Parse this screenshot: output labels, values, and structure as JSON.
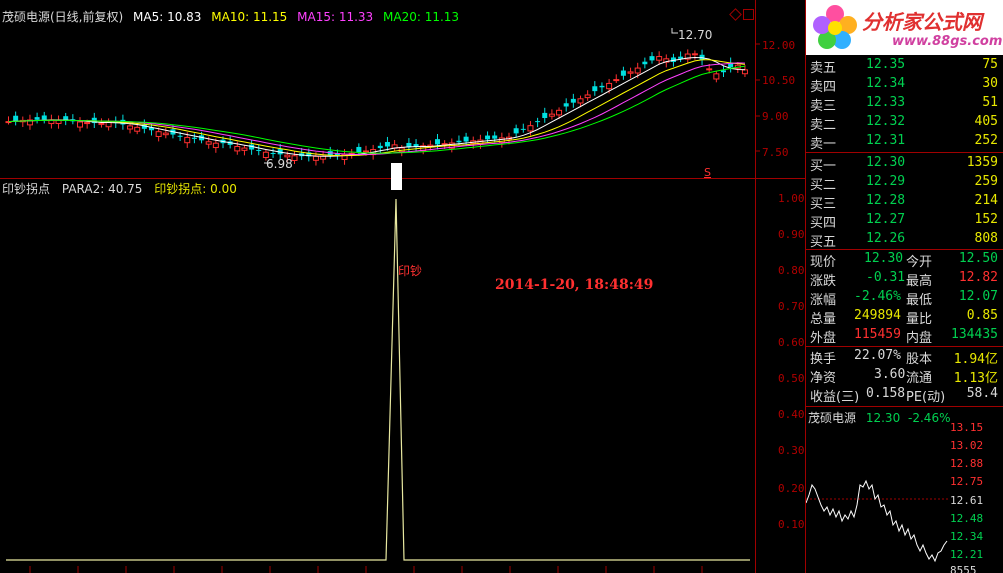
{
  "main_chart": {
    "title": "茂硕电源(日线,前复权)",
    "ma": [
      {
        "label": "MA5: 10.83",
        "color": "#ffffff"
      },
      {
        "label": "MA10: 11.15",
        "color": "#ffff00"
      },
      {
        "label": "MA15: 11.33",
        "color": "#ff40ff"
      },
      {
        "label": "MA20: 11.13",
        "color": "#00ff00"
      }
    ],
    "y_ticks": [
      "12.00",
      "10.50",
      "9.00",
      "7.50"
    ],
    "high_label": "12.70",
    "low_label": "6.98",
    "s_mark": "S"
  },
  "indicator": {
    "title": "印钞拐点",
    "para2": "PARA2: 40.75",
    "value": "印钞拐点: 0.00",
    "signal_label": "印钞",
    "timestamp": "2014-1-20, 18:48:49",
    "y_ticks": [
      "1.00",
      "0.90",
      "0.80",
      "0.70",
      "0.60",
      "0.50",
      "0.40",
      "0.30",
      "0.20",
      "0.10"
    ]
  },
  "logo": {
    "text": "分析家公式网",
    "url": "www.88gs.com"
  },
  "order_book": {
    "sell": [
      {
        "label": "卖五",
        "price": "12.35",
        "volume": "75"
      },
      {
        "label": "卖四",
        "price": "12.34",
        "volume": "30"
      },
      {
        "label": "卖三",
        "price": "12.33",
        "volume": "51"
      },
      {
        "label": "卖二",
        "price": "12.32",
        "volume": "405"
      },
      {
        "label": "卖一",
        "price": "12.31",
        "volume": "252"
      }
    ],
    "buy": [
      {
        "label": "买一",
        "price": "12.30",
        "volume": "1359"
      },
      {
        "label": "买二",
        "price": "12.29",
        "volume": "259"
      },
      {
        "label": "买三",
        "price": "12.28",
        "volume": "214"
      },
      {
        "label": "买四",
        "price": "12.27",
        "volume": "152"
      },
      {
        "label": "买五",
        "price": "12.26",
        "volume": "808"
      }
    ]
  },
  "stats": {
    "now_label": "现价",
    "now": "12.30",
    "open_label": "今开",
    "open": "12.50",
    "chg_label": "涨跌",
    "chg": "-0.31",
    "high_label": "最高",
    "high": "12.82",
    "pct_label": "涨幅",
    "pct": "-2.46%",
    "low_label": "最低",
    "low": "12.07",
    "vol_label": "总量",
    "vol": "249894",
    "ratio_label": "量比",
    "ratio": "0.85",
    "out_label": "外盘",
    "out": "115459",
    "in_label": "内盘",
    "in": "134435",
    "turn_label": "换手",
    "turn": "22.07%",
    "cap_label": "股本",
    "cap": "1.94亿",
    "nav_label": "净资",
    "nav": "3.60",
    "float_label": "流通",
    "float": "1.13亿",
    "eps_label": "收益(三)",
    "eps": "0.158",
    "pe_label": "PE(动)",
    "pe": "58.4"
  },
  "mini_chart": {
    "name": "茂硕电源",
    "price": "12.30",
    "pct": "-2.46%",
    "ticks": [
      "13.15",
      "13.02",
      "12.88",
      "12.75",
      "12.61",
      "12.48",
      "12.34",
      "12.21"
    ],
    "bottom_partial": "8555",
    "tick_colors": [
      "#ff3030",
      "#ff3030",
      "#ff3030",
      "#ff3030",
      "#d8d8d8",
      "#00d050",
      "#00d050",
      "#00d050"
    ]
  },
  "colors": {
    "up": "#ff3030",
    "down": "#00e0e0",
    "green": "#00d050",
    "yellow": "#e8e800",
    "frame": "#a00000"
  }
}
